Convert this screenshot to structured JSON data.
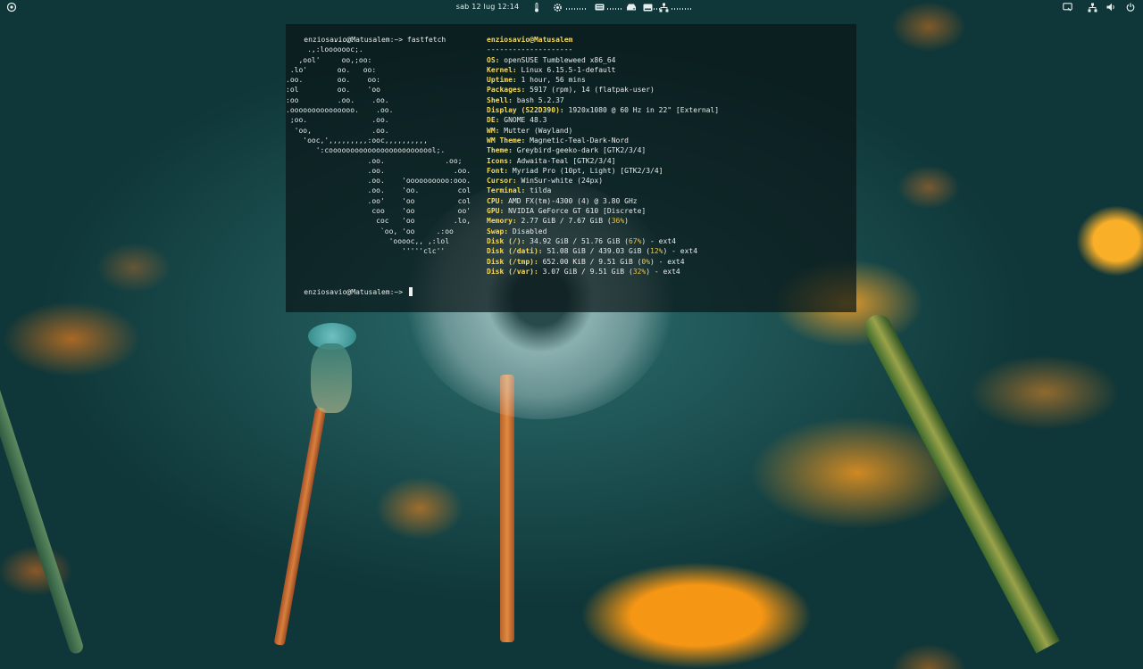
{
  "topbar": {
    "clock": "sab 12 lug  12:14"
  },
  "terminal": {
    "prompt": "enziosavio@Matusalem:~>",
    "command": "fastfetch",
    "logo": [
      "           .....",
      "     .,:looooooc;.",
      "   ,ool'     oo,;oo:",
      " .lo'       oo.   oo:",
      ".oo.        oo.    oo:",
      ":ol         oo.    'oo",
      ":oo         .oo.    .oo.",
      ".ooooooooooooooo.    .oo.",
      " ;oo.               .oo.",
      "  'oo,              .oo.",
      "    'ooc,',,,,,,,,,:ooc,,,,,,,,,,",
      "       ':cooooooooooooooooooooooool;.",
      "                   .oo.              .oo;",
      "                   .oo.                .oo.",
      "                   .oo.    'oooooooooo:ooo.",
      "                   .oo.    'oo.         col",
      "                   .oo'    'oo          col",
      "                    coo    'oo          oo'",
      "                     coc   'oo         .lo,",
      "                      `oo, 'oo     .:oo",
      "                        'ooooc,, ,:lol",
      "                           '''''clc''"
    ],
    "title": "enziosavio@Matusalem",
    "separator": "--------------------",
    "info": [
      {
        "key": "OS:",
        "value": " openSUSE Tumbleweed x86_64"
      },
      {
        "key": "Kernel:",
        "value": " Linux 6.15.5-1-default"
      },
      {
        "key": "Uptime:",
        "value": " 1 hour, 56 mins"
      },
      {
        "key": "Packages:",
        "value": " 5917 (rpm), 14 (flatpak-user)"
      },
      {
        "key": "Shell:",
        "value": " bash 5.2.37"
      },
      {
        "key": "Display (S22D390):",
        "value": " 1920x1080 @ 60 Hz in 22\" [External]"
      },
      {
        "key": "DE:",
        "value": " GNOME 48.3"
      },
      {
        "key": "WM:",
        "value": " Mutter (Wayland)"
      },
      {
        "key": "WM Theme:",
        "value": " Magnetic-Teal-Dark-Nord"
      },
      {
        "key": "Theme:",
        "value": " Greybird-geeko-dark [GTK2/3/4]"
      },
      {
        "key": "Icons:",
        "value": " Adwaita-Teal [GTK2/3/4]"
      },
      {
        "key": "Font:",
        "value": " Myriad Pro (10pt, Light) [GTK2/3/4]"
      },
      {
        "key": "Cursor:",
        "value": " WinSur-white (24px)"
      },
      {
        "key": "Terminal:",
        "value": " tilda"
      },
      {
        "key": "CPU:",
        "value": " AMD FX(tm)-4300 (4) @ 3.80 GHz"
      },
      {
        "key": "GPU:",
        "value": " NVIDIA GeForce GT 610 [Discrete]"
      },
      {
        "key": "Memory:",
        "value": " 2.77 GiB / 7.67 GiB (",
        "pct": "36%",
        "tail": ")"
      },
      {
        "key": "Swap:",
        "value": " Disabled"
      },
      {
        "key": "Disk (/):",
        "value": " 34.92 GiB / 51.76 GiB (",
        "pct": "67%",
        "tail": ") - ext4"
      },
      {
        "key": "Disk (/dati):",
        "value": " 51.08 GiB / 439.03 GiB (",
        "pct": "12%",
        "tail": ") - ext4"
      },
      {
        "key": "Disk (/tmp):",
        "value": " 652.00 KiB / 9.51 GiB (",
        "pct": "0%",
        "tail": ") - ext4"
      },
      {
        "key": "Disk (/var):",
        "value": " 3.07 GiB / 9.51 GiB (",
        "pct": "32%",
        "tail": ") - ext4"
      }
    ]
  }
}
